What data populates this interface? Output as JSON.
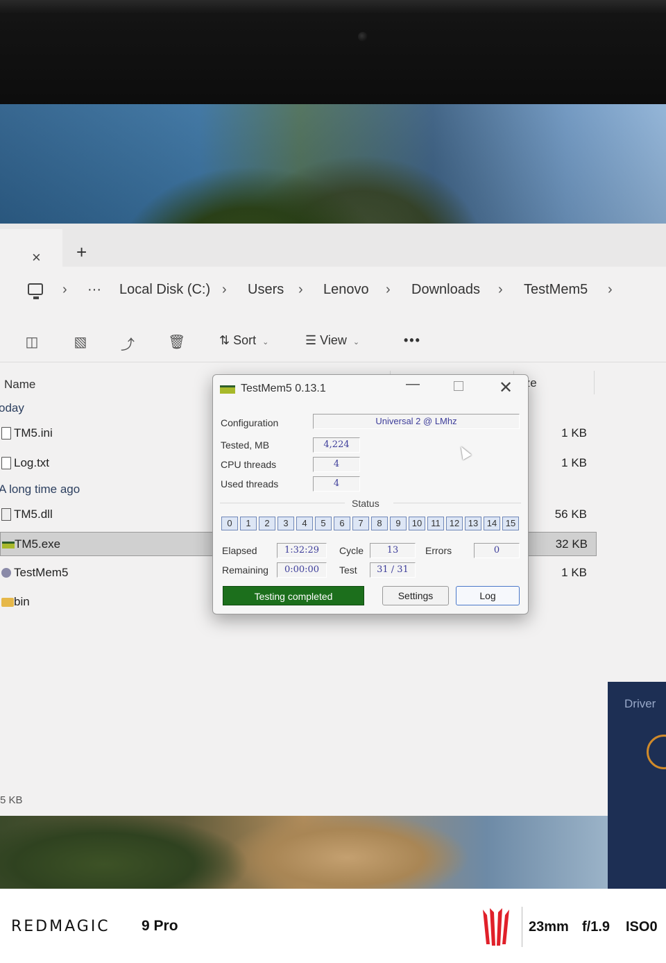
{
  "explorer": {
    "tab_close": "×",
    "tab_new": "+",
    "breadcrumb": {
      "more": "···",
      "items": [
        "Local Disk (C:)",
        "Users",
        "Lenovo",
        "Downloads",
        "TestMem5"
      ],
      "separator": "›"
    },
    "toolbar": {
      "sort_label": "Sort",
      "view_label": "View",
      "more_label": "•••"
    },
    "columns": {
      "name": "Name",
      "size": "ize"
    },
    "groups": {
      "today": "oday",
      "long_ago": "A long time ago"
    },
    "files": [
      {
        "name": "TM5.ini",
        "size": "1 KB",
        "icon": "doc-icon"
      },
      {
        "name": "Log.txt",
        "size": "1 KB",
        "icon": "doc-icon"
      },
      {
        "name": "TM5.dll",
        "size": "56 KB",
        "icon": "dll-icon"
      },
      {
        "name": "TM5.exe",
        "size": "32 KB",
        "icon": "exe-icon",
        "selected": true
      },
      {
        "name": "TestMem5",
        "size": "1 KB",
        "icon": "shortcut-icon"
      },
      {
        "name": "bin",
        "size": "",
        "icon": "folder-icon"
      }
    ],
    "status_footer": "5 KB"
  },
  "dialog": {
    "title": "TestMem5  0.13.1",
    "minimize": "—",
    "close": "✕",
    "configuration_label": "Configuration",
    "configuration_value": "Universal 2 @ LMhz",
    "tested_label": "Tested, MB",
    "tested_value": "4,224",
    "cpu_threads_label": "CPU threads",
    "cpu_threads_value": "4",
    "used_threads_label": "Used threads",
    "used_threads_value": "4",
    "status_label": "Status",
    "threads": [
      "0",
      "1",
      "2",
      "3",
      "4",
      "5",
      "6",
      "7",
      "8",
      "9",
      "10",
      "11",
      "12",
      "13",
      "14",
      "15"
    ],
    "elapsed_label": "Elapsed",
    "elapsed_value": "1:32:29",
    "remaining_label": "Remaining",
    "remaining_value": "0:00:00",
    "cycle_label": "Cycle",
    "cycle_value": "13",
    "test_label": "Test",
    "test_value": "31 / 31",
    "errors_label": "Errors",
    "errors_value": "0",
    "completed_label": "Testing completed",
    "settings_label": "Settings",
    "log_label": "Log",
    "completed_color": "#1c6f1c"
  },
  "widget": {
    "title": "Driver"
  },
  "watermark": {
    "brand": "REDMAGIC",
    "model": "9 Pro",
    "focal": "23mm",
    "aperture": "f/1.9",
    "iso": "ISO0"
  }
}
